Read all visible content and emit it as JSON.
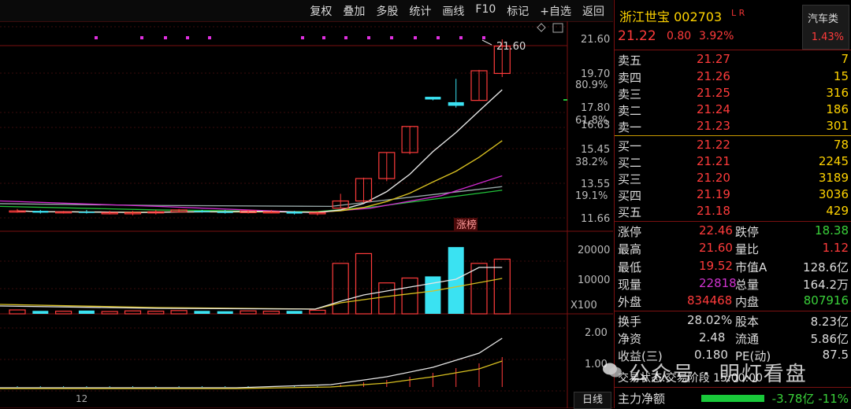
{
  "toolbar": {
    "items": [
      "复权",
      "叠加",
      "多股",
      "统计",
      "画线",
      "F10",
      "标记",
      "+自选",
      "返回"
    ]
  },
  "stock": {
    "name_code": "浙江世宝 002703",
    "flags": "L R",
    "price": "21.22",
    "change": "0.80",
    "change_pct": "3.92%",
    "sector_name": "汽车类",
    "sector_pct": "1.43%"
  },
  "orderbook": {
    "asks": [
      {
        "label": "卖五",
        "price": "21.27",
        "vol": "7"
      },
      {
        "label": "卖四",
        "price": "21.26",
        "vol": "15"
      },
      {
        "label": "卖三",
        "price": "21.25",
        "vol": "316"
      },
      {
        "label": "卖二",
        "price": "21.24",
        "vol": "186"
      },
      {
        "label": "卖一",
        "price": "21.23",
        "vol": "301"
      }
    ],
    "bids": [
      {
        "label": "买一",
        "price": "21.22",
        "vol": "78"
      },
      {
        "label": "买二",
        "price": "21.21",
        "vol": "2245"
      },
      {
        "label": "买三",
        "price": "21.20",
        "vol": "3189"
      },
      {
        "label": "买四",
        "price": "21.19",
        "vol": "3036"
      },
      {
        "label": "买五",
        "price": "21.18",
        "vol": "429"
      }
    ]
  },
  "stats": {
    "zt_label": "涨停",
    "zt": "22.46",
    "dt_label": "跌停",
    "dt": "18.38",
    "hi_label": "最高",
    "hi": "21.60",
    "lb_label": "量比",
    "lb": "1.12",
    "lo_label": "最低",
    "lo": "19.52",
    "sz_label": "市值A",
    "sz": "128.6亿",
    "xl_label": "现量",
    "xl": "22818",
    "zl_label": "总量",
    "zl": "164.2万",
    "wp_label": "外盘",
    "wp": "834468",
    "np_label": "内盘",
    "np": "807916",
    "hs_label": "换手",
    "hs": "28.02%",
    "gb_label": "股本",
    "gb": "8.23亿",
    "jz_label": "净资",
    "jz": "2.48",
    "lt_label": "流通",
    "lt": "5.86亿",
    "sy_label": "收益(三)",
    "sy": "0.180",
    "pe_label": "PE(动)",
    "pe": "87.5",
    "trade_status": "交易状态:交易阶段 15:00:00",
    "zljn_label": "主力净额",
    "zljn": "-3.78亿 -11%"
  },
  "watermark": "公众号 · 明灯看盘",
  "period_tab": "日线",
  "date_tick": "12",
  "chart_data": {
    "type": "candlestick",
    "price_axis_labels": [
      "21.60",
      "19.70",
      "17.80",
      "16.63",
      "15.45",
      "13.55",
      "11.66"
    ],
    "pct_axis_labels": [
      "80.9%",
      "61.8%",
      "38.2%",
      "19.1%"
    ],
    "max_marker": "21.60",
    "limit_up_tag": "涨榜",
    "volume_axis_labels": [
      "20000",
      "10000"
    ],
    "volume_unit": "X100",
    "macd_axis_labels": [
      "2.00",
      "1.00"
    ],
    "candles": [
      {
        "o": 12.0,
        "h": 12.15,
        "l": 11.95,
        "c": 12.05
      },
      {
        "o": 12.05,
        "h": 12.1,
        "l": 11.9,
        "c": 11.95
      },
      {
        "o": 11.95,
        "h": 12.05,
        "l": 11.9,
        "c": 12.0
      },
      {
        "o": 12.0,
        "h": 12.1,
        "l": 11.9,
        "c": 11.95
      },
      {
        "o": 11.95,
        "h": 12.05,
        "l": 11.85,
        "c": 11.95
      },
      {
        "o": 11.9,
        "h": 12.05,
        "l": 11.8,
        "c": 11.95
      },
      {
        "o": 11.95,
        "h": 12.1,
        "l": 11.85,
        "c": 12.0
      },
      {
        "o": 12.0,
        "h": 12.15,
        "l": 11.95,
        "c": 12.1
      },
      {
        "o": 12.05,
        "h": 12.1,
        "l": 11.95,
        "c": 12.0
      },
      {
        "o": 12.0,
        "h": 12.1,
        "l": 11.9,
        "c": 11.95
      },
      {
        "o": 11.95,
        "h": 12.1,
        "l": 11.9,
        "c": 12.05
      },
      {
        "o": 12.0,
        "h": 12.1,
        "l": 11.95,
        "c": 12.0
      },
      {
        "o": 12.0,
        "h": 12.05,
        "l": 11.85,
        "c": 11.9
      },
      {
        "o": 11.9,
        "h": 12.0,
        "l": 11.8,
        "c": 11.95
      },
      {
        "o": 12.2,
        "h": 13.0,
        "l": 12.2,
        "c": 12.6
      },
      {
        "o": 12.6,
        "h": 13.9,
        "l": 12.5,
        "c": 13.85
      },
      {
        "o": 13.85,
        "h": 15.3,
        "l": 13.7,
        "c": 15.3
      },
      {
        "o": 15.3,
        "h": 16.75,
        "l": 15.2,
        "c": 16.75
      },
      {
        "o": 18.4,
        "h": 18.4,
        "l": 18.2,
        "c": 18.25
      },
      {
        "o": 18.1,
        "h": 19.4,
        "l": 17.8,
        "c": 17.9
      },
      {
        "o": 18.2,
        "h": 19.9,
        "l": 18.2,
        "c": 19.85
      },
      {
        "o": 19.7,
        "h": 21.6,
        "l": 19.5,
        "c": 21.22
      }
    ],
    "volumes": [
      1200,
      900,
      800,
      1000,
      700,
      900,
      800,
      1000,
      900,
      800,
      900,
      800,
      900,
      1100,
      15500,
      18500,
      9500,
      11000,
      11500,
      20500,
      15500,
      16800
    ]
  }
}
